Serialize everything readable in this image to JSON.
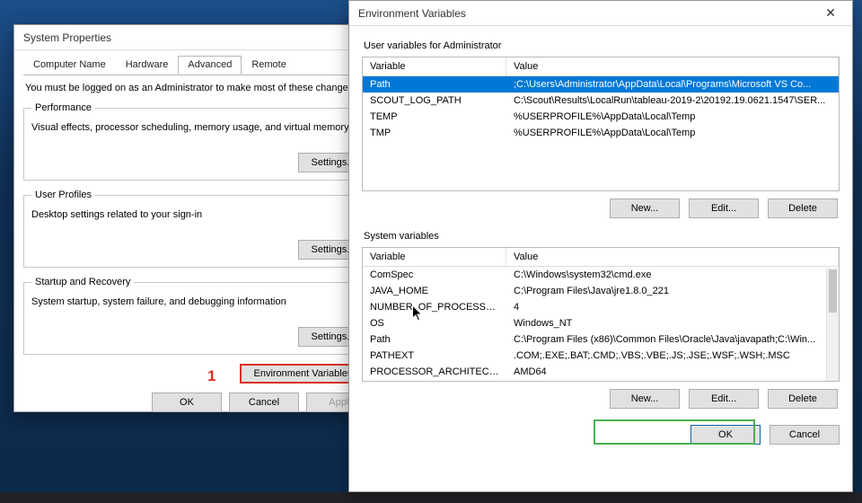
{
  "sysprops": {
    "title": "System Properties",
    "tabs": [
      "Computer Name",
      "Hardware",
      "Advanced",
      "Remote"
    ],
    "active_tab_index": 2,
    "note": "You must be logged on as an Administrator to make most of these changes.",
    "groups": {
      "performance": {
        "legend": "Performance",
        "desc": "Visual effects, processor scheduling, memory usage, and virtual memory",
        "button": "Settings..."
      },
      "userprofiles": {
        "legend": "User Profiles",
        "desc": "Desktop settings related to your sign-in",
        "button": "Settings..."
      },
      "startup": {
        "legend": "Startup and Recovery",
        "desc": "System startup, system failure, and debugging information",
        "button": "Settings..."
      }
    },
    "env_button": "Environment Variables...",
    "buttons": {
      "ok": "OK",
      "cancel": "Cancel",
      "apply": "Apply"
    },
    "annotation_number": "1"
  },
  "envvars": {
    "title": "Environment Variables",
    "user_section_label": "User variables for Administrator",
    "system_section_label": "System variables",
    "columns": {
      "var": "Variable",
      "val": "Value"
    },
    "user_rows": [
      {
        "var": "Path",
        "val": ";C:\\Users\\Administrator\\AppData\\Local\\Programs\\Microsoft VS Co..."
      },
      {
        "var": "SCOUT_LOG_PATH",
        "val": "C:\\Scout\\Results\\LocalRun\\tableau-2019-2\\20192.19.0621.1547\\SER..."
      },
      {
        "var": "TEMP",
        "val": "%USERPROFILE%\\AppData\\Local\\Temp"
      },
      {
        "var": "TMP",
        "val": "%USERPROFILE%\\AppData\\Local\\Temp"
      }
    ],
    "user_selected_index": 0,
    "system_rows": [
      {
        "var": "ComSpec",
        "val": "C:\\Windows\\system32\\cmd.exe"
      },
      {
        "var": "JAVA_HOME",
        "val": "C:\\Program Files\\Java\\jre1.8.0_221"
      },
      {
        "var": "NUMBER_OF_PROCESSORS",
        "val": "4"
      },
      {
        "var": "OS",
        "val": "Windows_NT"
      },
      {
        "var": "Path",
        "val": "C:\\Program Files (x86)\\Common Files\\Oracle\\Java\\javapath;C:\\Win..."
      },
      {
        "var": "PATHEXT",
        "val": ".COM;.EXE;.BAT;.CMD;.VBS;.VBE;.JS;.JSE;.WSF;.WSH;.MSC"
      },
      {
        "var": "PROCESSOR_ARCHITECTURE",
        "val": "AMD64"
      }
    ],
    "buttons": {
      "new": "New...",
      "edit": "Edit...",
      "delete": "Delete",
      "ok": "OK",
      "cancel": "Cancel"
    }
  }
}
